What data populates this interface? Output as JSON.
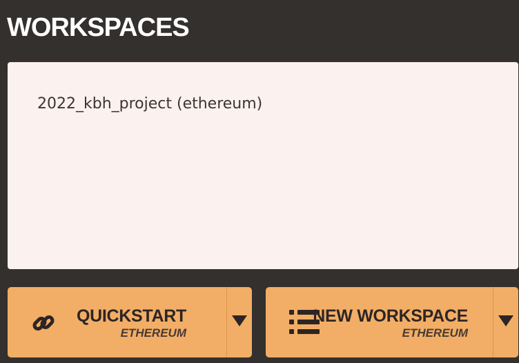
{
  "header": {
    "title": "WORKSPACES"
  },
  "workspaces": [
    {
      "label": "2022_kbh_project (ethereum)"
    }
  ],
  "actions": {
    "quickstart": {
      "label": "QUICKSTART",
      "sublabel": "ETHEREUM",
      "icon": "link-icon",
      "dropdown_icon": "caret-down-icon"
    },
    "new_workspace": {
      "label": "NEW WORKSPACE",
      "sublabel": "ETHEREUM",
      "icon": "list-icon",
      "dropdown_icon": "caret-down-icon"
    }
  },
  "colors": {
    "background": "#33302e",
    "panel": "#fbf1ee",
    "button": "#f2ae66",
    "text_dark": "#2d2523",
    "title": "#ffffff"
  }
}
